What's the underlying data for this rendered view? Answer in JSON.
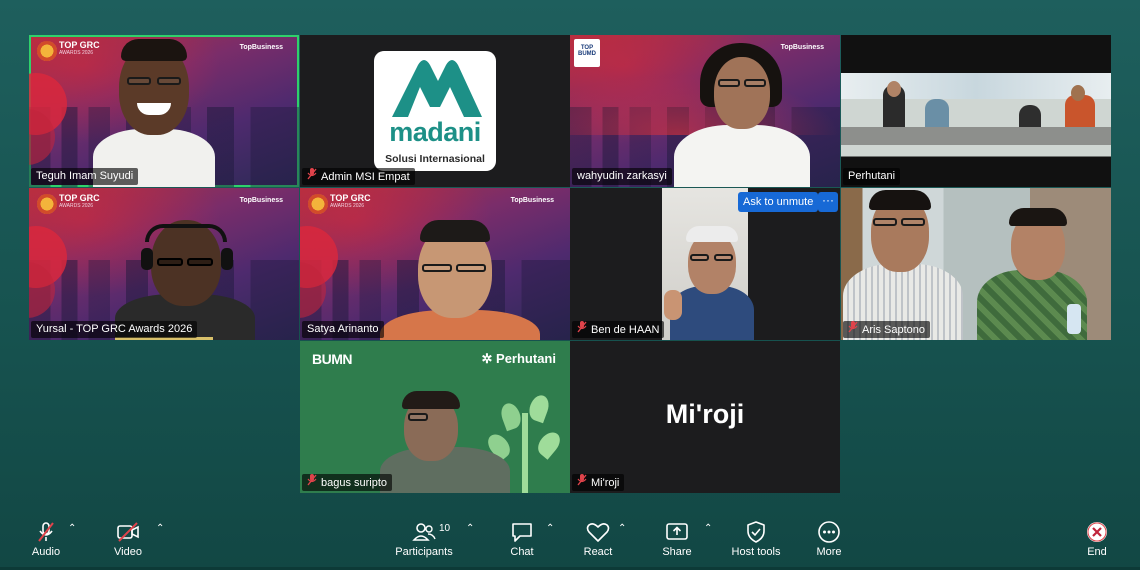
{
  "tiles": {
    "t1": {
      "name": "Teguh Imam Suyudi",
      "muted": false,
      "active": true,
      "badge_title": "TOP GRC",
      "badge_sub": "AWARDS 2026",
      "brand": "TopBusiness"
    },
    "t2": {
      "name": "Admin MSI Empat",
      "muted": true,
      "logo_word": "madani",
      "logo_sub": "Solusi Internasional"
    },
    "t3": {
      "name": "wahyudin zarkasyi",
      "muted": false,
      "badge_title": "TOP BUMD",
      "brand": "TopBusiness"
    },
    "t4": {
      "name": "Perhutani",
      "muted": false
    },
    "t5": {
      "name": "Yursal - TOP GRC Awards 2026",
      "muted": false,
      "badge_title": "TOP GRC",
      "badge_sub": "AWARDS 2026",
      "brand": "TopBusiness"
    },
    "t6": {
      "name": "Satya Arinanto",
      "muted": false,
      "badge_title": "TOP GRC",
      "badge_sub": "AWARDS 2026",
      "brand": "TopBusiness"
    },
    "t7": {
      "name": "Ben de HAAN",
      "muted": true,
      "unmute_label": "Ask to unmute",
      "more_label": "···"
    },
    "t8": {
      "name": "Aris Saptono",
      "muted": true
    },
    "t9": {
      "name": "bagus suripto",
      "muted": true,
      "bg_left": "BUMN",
      "bg_right": "Perhutani"
    },
    "t10": {
      "name": "Mi'roji",
      "muted": true,
      "display_name": "Mi'roji"
    }
  },
  "toolbar": {
    "audio": "Audio",
    "video": "Video",
    "participants": "Participants",
    "participants_count": "10",
    "chat": "Chat",
    "react": "React",
    "share": "Share",
    "host_tools": "Host tools",
    "more": "More",
    "end": "End"
  },
  "colors": {
    "background": "#1a5856",
    "active_border": "#2fd16b",
    "muted_icon": "#e0434b",
    "unmute_button": "#1769d6"
  }
}
